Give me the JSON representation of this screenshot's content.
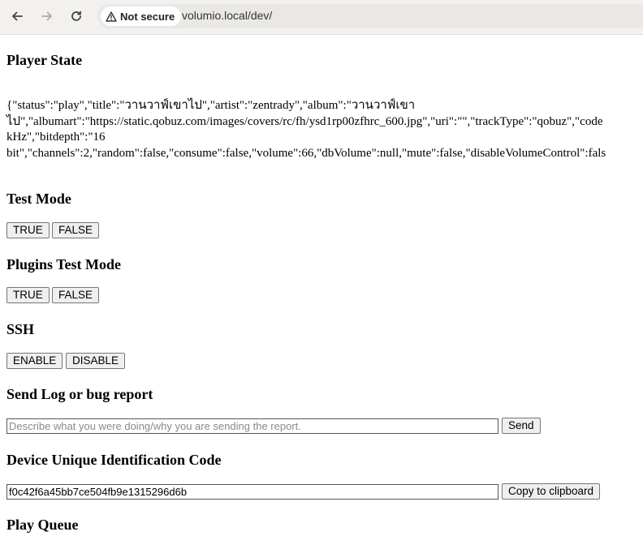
{
  "browser": {
    "security_label": "Not secure",
    "url": "volumio.local/dev/"
  },
  "player_state": {
    "heading": "Player State",
    "lines": [
      "{\"status\":\"play\",\"title\":\"วานวาฟ์เขาไป\",\"artist\":\"zentrady\",\"album\":\"วานวาฟ์เขา",
      "ไป\",\"albumart\":\"https://static.qobuz.com/images/covers/rc/fh/ysd1rp00zfhrc_600.jpg\",\"uri\":\"\",\"trackType\":\"qobuz\",\"code",
      "kHz\",\"bitdepth\":\"16",
      "bit\",\"channels\":2,\"random\":false,\"consume\":false,\"volume\":66,\"dbVolume\":null,\"mute\":false,\"disableVolumeControl\":fals"
    ]
  },
  "test_mode": {
    "heading": "Test Mode",
    "true_label": "TRUE",
    "false_label": "FALSE"
  },
  "plugins_test_mode": {
    "heading": "Plugins Test Mode",
    "true_label": "TRUE",
    "false_label": "FALSE"
  },
  "ssh": {
    "heading": "SSH",
    "enable_label": "ENABLE",
    "disable_label": "DISABLE"
  },
  "send_log": {
    "heading": "Send Log or bug report",
    "placeholder": "Describe what you were doing/why you are sending the report.",
    "value": "",
    "send_label": "Send"
  },
  "device_id": {
    "heading": "Device Unique Identification Code",
    "value": "f0c42f6a45bb7ce504fb9e1315296d6b",
    "copy_label": "Copy to clipboard"
  },
  "play_queue": {
    "heading": "Play Queue"
  }
}
